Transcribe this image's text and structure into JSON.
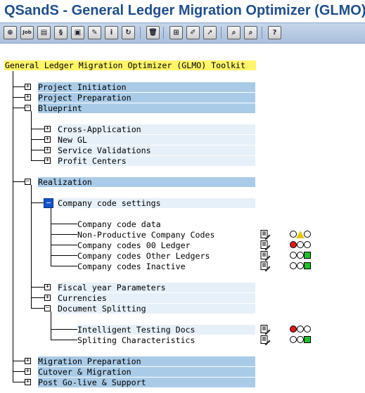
{
  "title": "QSandS - General Ledger Migration Optimizer (GLMO)",
  "toolbar": {
    "buttons": [
      {
        "name": "execute-button",
        "glyph": "⊕"
      },
      {
        "name": "job-button",
        "glyph": "Job"
      },
      {
        "name": "document-button",
        "glyph": "▤"
      },
      {
        "name": "script-button",
        "glyph": "§"
      },
      {
        "name": "save-button",
        "glyph": "▣"
      },
      {
        "name": "check-button",
        "glyph": "✎"
      },
      {
        "name": "info-button",
        "glyph": "i"
      },
      {
        "name": "refresh-button",
        "glyph": "↻"
      },
      {
        "name": "delete-button",
        "glyph": "🗑"
      },
      {
        "name": "add-node-button",
        "glyph": "⊞"
      },
      {
        "name": "edit-node-button",
        "glyph": "✐"
      },
      {
        "name": "select-button",
        "glyph": "➚"
      },
      {
        "name": "find-button",
        "glyph": "⌕"
      },
      {
        "name": "find-next-button",
        "glyph": "⌕"
      },
      {
        "name": "help-button",
        "glyph": "?"
      }
    ]
  },
  "tree": {
    "root": "General Ledger Migration Optimizer (GLMO) Toolkit",
    "project_initiation": "Project Initiation",
    "project_preparation": "Project Preparation",
    "blueprint": "Blueprint",
    "cross_application": "Cross-Application",
    "new_gl": "New GL",
    "service_validations": "Service Validations",
    "profit_centers": "Profit Centers",
    "realization": "Realization",
    "company_code_settings": "Company code settings",
    "company_code_data": "Company code data",
    "non_productive": "Non-Productive Company Codes",
    "cc_00_ledger": "Company codes 00 Ledger",
    "cc_other_ledgers": "Company codes Other Ledgers",
    "cc_inactive": "Company codes Inactive",
    "fiscal_year": "Fiscal year Parameters",
    "currencies": "Currencies",
    "document_splitting": "Document Splitting",
    "intelligent_testing": "Intelligent Testing Docs",
    "spliting_characteristics": "Spliting Characteristics",
    "migration_preparation": "Migration Preparation",
    "cutover_migration": "Cutover & Migration",
    "post_go_live": "Post Go-live & Support"
  },
  "status": {
    "non_productive": "yellow",
    "cc_00_ledger": "red",
    "cc_other_ledgers": "green",
    "cc_inactive": "green",
    "intelligent_testing": "red",
    "spliting_characteristics": "green"
  },
  "colors": {
    "title": "#1f4f8f",
    "header_bg": "#fff56a",
    "folder_row_bg": "#a9cbe7",
    "sub_row_bg": "#e6f0f8",
    "red": "#e01818",
    "yellow": "#e6c800",
    "green": "#22c02a"
  }
}
